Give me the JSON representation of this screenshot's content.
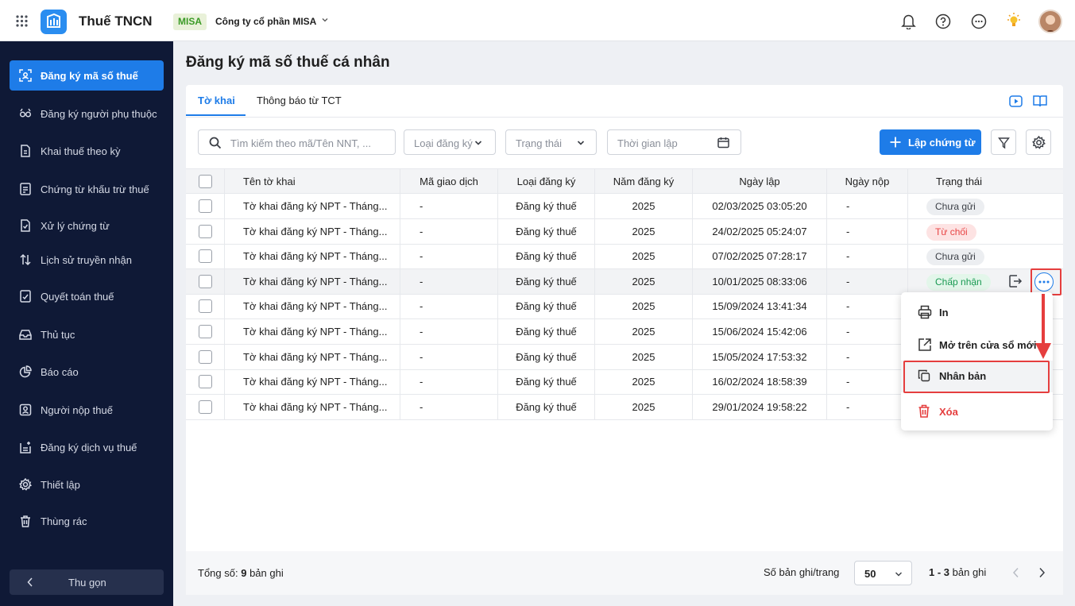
{
  "app": {
    "title": "Thuế TNCN",
    "company_tag": "MISA",
    "company_name": "Công ty cổ phần MISA"
  },
  "sidebar": {
    "items": [
      {
        "label": "Đăng ký mã số thuế",
        "icon": "scan-icon",
        "active": true
      },
      {
        "label": "Đăng ký người phụ thuộc",
        "icon": "people-icon"
      },
      {
        "label": "Khai thuế theo kỳ",
        "icon": "document-icon"
      },
      {
        "label": "Chứng từ khấu trừ thuế",
        "icon": "receipt-icon"
      },
      {
        "label": "Xử lý chứng từ",
        "icon": "document-check-icon"
      },
      {
        "label": "Lịch sử truyền nhận",
        "icon": "transfer-arrows-icon"
      },
      {
        "label": "Quyết toán thuế",
        "icon": "finalize-icon"
      },
      {
        "label": "Thủ tục",
        "icon": "inbox-icon"
      },
      {
        "label": "Báo cáo",
        "icon": "pie-chart-icon"
      },
      {
        "label": "Người nộp thuế",
        "icon": "person-card-icon"
      },
      {
        "label": "Đăng ký dịch vụ thuế",
        "icon": "service-register-icon"
      },
      {
        "label": "Thiết lập",
        "icon": "gear-icon"
      },
      {
        "label": "Thùng rác",
        "icon": "trash-icon"
      }
    ],
    "collapse_label": "Thu gọn"
  },
  "page": {
    "title": "Đăng ký mã số thuế cá nhân"
  },
  "tabs": [
    {
      "label": "Tờ khai",
      "active": true
    },
    {
      "label": "Thông báo từ TCT"
    }
  ],
  "filters": {
    "search_placeholder": "Tìm kiếm theo mã/Tên NNT, ...",
    "type_label": "Loại đăng ký",
    "status_label": "Trạng thái",
    "date_label": "Thời gian lập",
    "create_button": "Lập chứng từ"
  },
  "table": {
    "headers": [
      "Tên tờ khai",
      "Mã giao dịch",
      "Loại đăng ký",
      "Năm đăng ký",
      "Ngày lập",
      "Ngày nộp",
      "Trạng thái"
    ],
    "rows": [
      {
        "name": "Tờ khai đăng ký NPT - Tháng...",
        "code": "-",
        "type": "Đăng ký thuế",
        "year": "2025",
        "created": "02/03/2025 03:05:20",
        "submitted": "-",
        "status": "Chưa gửi",
        "status_kind": "gray"
      },
      {
        "name": "Tờ khai đăng ký NPT - Tháng...",
        "code": "-",
        "type": "Đăng ký thuế",
        "year": "2025",
        "created": "24/02/2025 05:24:07",
        "submitted": "-",
        "status": "Từ chối",
        "status_kind": "red"
      },
      {
        "name": "Tờ khai đăng ký NPT - Tháng...",
        "code": "-",
        "type": "Đăng ký thuế",
        "year": "2025",
        "created": "07/02/2025 07:28:17",
        "submitted": "-",
        "status": "Chưa gửi",
        "status_kind": "gray"
      },
      {
        "name": "Tờ khai đăng ký NPT - Tháng...",
        "code": "-",
        "type": "Đăng ký thuế",
        "year": "2025",
        "created": "10/01/2025 08:33:06",
        "submitted": "-",
        "status": "Chấp nhận",
        "status_kind": "green",
        "highlighted": true
      },
      {
        "name": "Tờ khai đăng ký NPT - Tháng...",
        "code": "-",
        "type": "Đăng ký thuế",
        "year": "2025",
        "created": "15/09/2024 13:41:34",
        "submitted": "-",
        "status": "",
        "status_kind": ""
      },
      {
        "name": "Tờ khai đăng ký NPT - Tháng...",
        "code": "-",
        "type": "Đăng ký thuế",
        "year": "2025",
        "created": "15/06/2024 15:42:06",
        "submitted": "-",
        "status": "",
        "status_kind": ""
      },
      {
        "name": "Tờ khai đăng ký NPT - Tháng...",
        "code": "-",
        "type": "Đăng ký thuế",
        "year": "2025",
        "created": "15/05/2024 17:53:32",
        "submitted": "-",
        "status": "",
        "status_kind": ""
      },
      {
        "name": "Tờ khai đăng ký NPT - Tháng...",
        "code": "-",
        "type": "Đăng ký thuế",
        "year": "2025",
        "created": "16/02/2024 18:58:39",
        "submitted": "-",
        "status": "",
        "status_kind": ""
      },
      {
        "name": "Tờ khai đăng ký NPT - Tháng...",
        "code": "-",
        "type": "Đăng ký thuế",
        "year": "2025",
        "created": "29/01/2024 19:58:22",
        "submitted": "-",
        "status": "",
        "status_kind": ""
      }
    ]
  },
  "context_menu": {
    "items": [
      "In",
      "Mở trên cửa sổ mới",
      "Nhân bản",
      "Xóa"
    ]
  },
  "footer": {
    "total_prefix": "Tổng số:",
    "total_count": "9",
    "total_suffix": "bản ghi",
    "per_page_label": "Số bản ghi/trang",
    "per_page_value": "50",
    "range": "1 - 3",
    "range_suffix": "bản ghi"
  },
  "colors": {
    "primary": "#1e7ce8",
    "sidebar_bg": "#0f1936",
    "danger": "#e53e3e",
    "success": "#1a9a53"
  }
}
